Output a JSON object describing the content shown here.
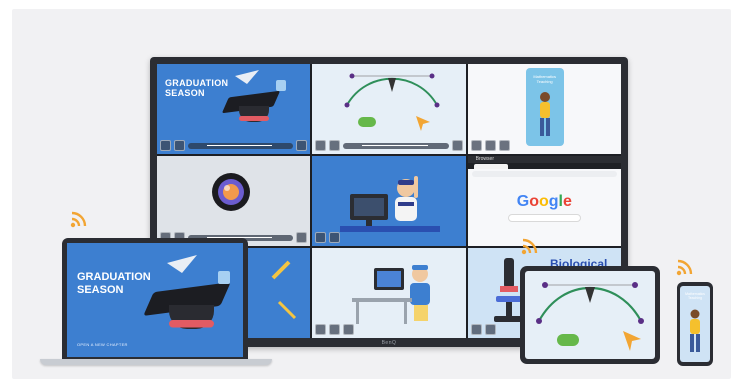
{
  "display": {
    "brand": "BenQ",
    "tiles": [
      {
        "title": "GRADUATION SEASON"
      },
      {
        "title": ""
      },
      {
        "title": "Mathematics Teaching"
      },
      {
        "title": ""
      },
      {
        "title": ""
      },
      {
        "title": "Browser",
        "search_engine": "Google"
      },
      {
        "title": ""
      },
      {
        "title": ""
      },
      {
        "title": "Biological"
      }
    ]
  },
  "laptop": {
    "title": "GRADUATION SEASON",
    "footer": "OPEN A NEW CHAPTER"
  },
  "phone": {
    "title": "Mathematics Teaching"
  },
  "colors": {
    "accent_blue": "#3d7fd0",
    "cast_orange": "#f2a533",
    "device_frame": "#2b2d33"
  },
  "icons": [
    "wifi-cast-icon",
    "graduation-cap-icon",
    "pen-tool-icon",
    "cursor-icon"
  ]
}
